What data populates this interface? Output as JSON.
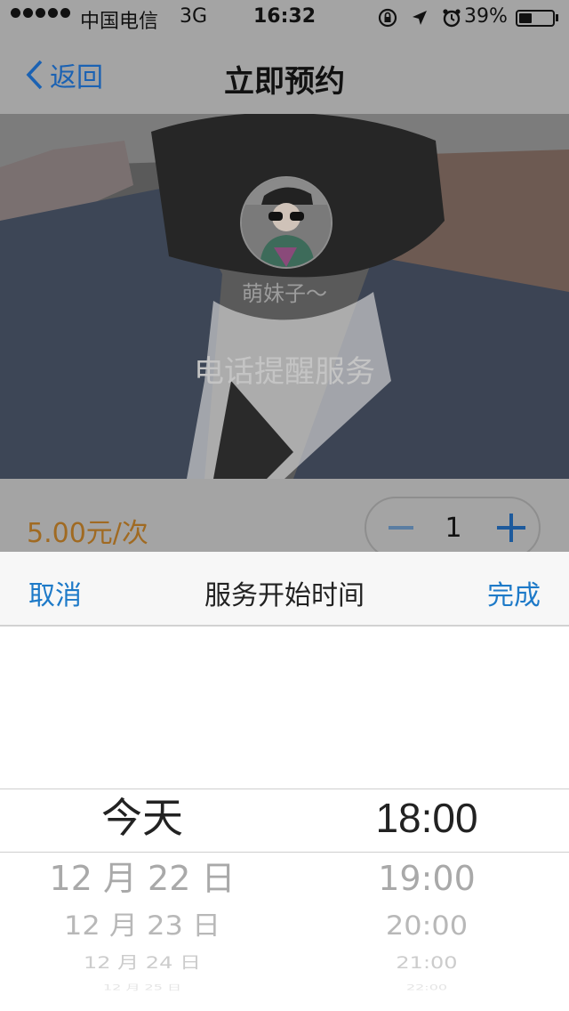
{
  "status_bar": {
    "carrier": "中国电信",
    "network": "3G",
    "time": "16:32",
    "battery_percent": "39%",
    "battery_level": 0.39,
    "icons": [
      "rotation-lock-icon",
      "location-arrow-icon",
      "alarm-icon"
    ]
  },
  "nav": {
    "back_label": "返回",
    "title": "立即预约"
  },
  "hero": {
    "username": "萌妹子～",
    "service_name": "电话提醒服务"
  },
  "order": {
    "price": "5.00元/次",
    "quantity": "1"
  },
  "picker": {
    "cancel_label": "取消",
    "title": "服务开始时间",
    "done_label": "完成",
    "date_options": [
      "今天",
      "12 月 22 日",
      "12 月 23 日",
      "12 月 24 日",
      "12 月 25 日"
    ],
    "time_options": [
      "18:00",
      "19:00",
      "20:00",
      "21:00",
      "22:00"
    ],
    "selected_date": "今天",
    "selected_time": "18:00"
  },
  "colors": {
    "accent": "#1e7ac8",
    "price": "#a06a22",
    "overlay_gray": "#a4a4a4"
  }
}
